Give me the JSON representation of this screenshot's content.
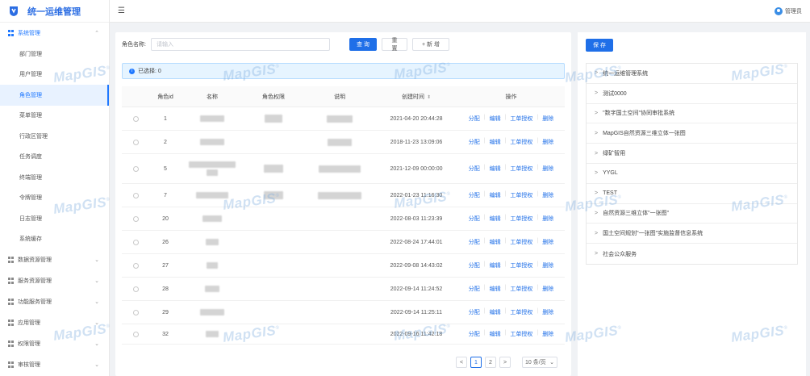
{
  "app": {
    "title": "统一运维管理"
  },
  "header": {
    "username": "管理员",
    "fold_icon": "menu-fold-icon"
  },
  "sidebar": {
    "groups_top": [
      {
        "label": "系统管理",
        "open": true,
        "items": [
          "部门管理",
          "用户管理",
          "角色管理",
          "菜单管理",
          "行政区管理",
          "任务调度",
          "终端管理",
          "令牌管理",
          "日志管理",
          "系统缓存"
        ],
        "active": "角色管理"
      }
    ],
    "groups_rest": [
      {
        "label": "数据资源管理"
      },
      {
        "label": "服务资源管理"
      },
      {
        "label": "功能服务管理"
      },
      {
        "label": "应用管理"
      },
      {
        "label": "权限管理"
      },
      {
        "label": "审核管理"
      }
    ]
  },
  "search": {
    "label": "角色名称:",
    "placeholder": "请输入",
    "query": "查 询",
    "reset": "重 置",
    "add": "+ 新 增"
  },
  "alert": {
    "text": "已选择: 0"
  },
  "table": {
    "headers": {
      "id": "角色id",
      "name": "名称",
      "perm": "角色权限",
      "desc": "说明",
      "time": "创建时间",
      "ops": "操作"
    },
    "ops": [
      "分配",
      "编辑",
      "工单授权",
      "删除"
    ],
    "rows": [
      {
        "id": "1",
        "time": "2021-04-20 20:44:28"
      },
      {
        "id": "2",
        "time": "2018-11-23 13:09:06"
      },
      {
        "id": "5",
        "time": "2021-12-09 00:00:00"
      },
      {
        "id": "7",
        "time": "2022-01-23 11:16:30"
      },
      {
        "id": "20",
        "time": "2022-08-03 11:23:39"
      },
      {
        "id": "26",
        "time": "2022-08-24 17:44:01"
      },
      {
        "id": "27",
        "time": "2022-09-08 14:43:02"
      },
      {
        "id": "28",
        "time": "2022-09-14 11:24:52"
      },
      {
        "id": "29",
        "time": "2022-09-14 11:25:11"
      },
      {
        "id": "32",
        "time": "2022-09-16 11:42:18"
      }
    ]
  },
  "pagination": {
    "prev": "<",
    "pages": [
      "1",
      "2"
    ],
    "current": "1",
    "next": ">",
    "size": "10 条/页"
  },
  "right": {
    "save": "保 存",
    "tree": [
      "统一运维管理系统",
      "测试0000",
      "\"数字国土空间\"协同审批系统",
      "MapGIS自然资源三维立体一张图",
      "绿矿智用",
      "YYGL",
      "TEST",
      "自然资源三维立体\"一张图\"",
      "国土空间规划\"一张图\"实施监督信息系统",
      "社会公众服务"
    ]
  },
  "watermark": "MapGIS",
  "colors": {
    "primary": "#1f6fe8",
    "brand": "#2b6de3",
    "active_bg": "#e8f2ff"
  }
}
